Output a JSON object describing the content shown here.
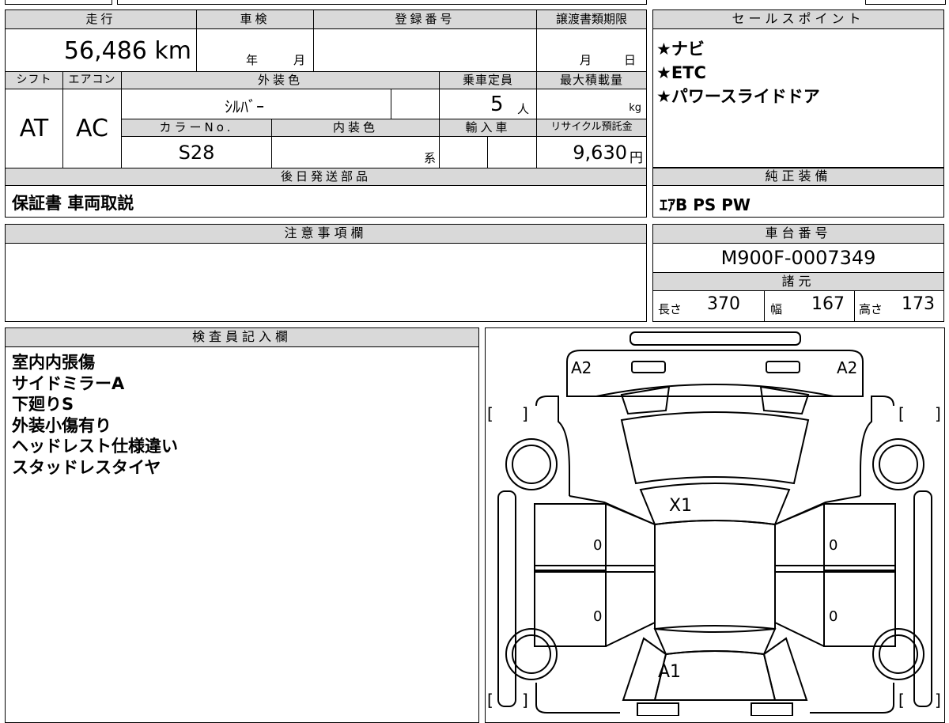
{
  "form": {
    "headers": {
      "mileage": "走行",
      "inspection": "車検",
      "registration": "登録番号",
      "transfer_deadline": "譲渡書類期限",
      "sales_points": "セールスポイント",
      "shift": "シフト",
      "aircon": "エアコン",
      "exterior_color": "外装色",
      "capacity": "乗車定員",
      "max_load": "最大積載量",
      "color_no": "カラーNo.",
      "interior_color": "内装色",
      "import": "輸入車",
      "recycle": "リサイクル預託金",
      "later_parts": "後日発送部品",
      "standard_equipment": "純正装備",
      "notes": "注意事項欄",
      "chassis_no": "車台番号",
      "specs": "諸元",
      "inspector": "検査員記入欄"
    },
    "values": {
      "mileage": "56,486 km",
      "inspection_year": "年",
      "inspection_month": "月",
      "transfer_month": "月",
      "transfer_day": "日",
      "shift": "AT",
      "aircon": "AC",
      "exterior_color": "ｼﾙﾊﾞｰ",
      "capacity_num": "5",
      "capacity_unit": "人",
      "max_load_unit": "kg",
      "color_no": "S28",
      "interior_suffix": "系",
      "recycle_fee": "9,630",
      "recycle_unit": "円",
      "later_parts": "保証書 車両取説",
      "standard_equipment": "ｴｱB PS PW",
      "chassis_no": "M900F-0007349",
      "length_label": "長さ",
      "length": "370",
      "width_label": "幅",
      "width": "167",
      "height_label": "高さ",
      "height": "173"
    },
    "sales_points": [
      "★ナビ",
      "★ETC",
      "★パワースライドドア"
    ],
    "inspector_notes": [
      "室内内張傷",
      "サイドミラーA",
      "下廻りS",
      "外装小傷有り",
      "ヘッドレスト仕様違い",
      "スタッドレスタイヤ"
    ],
    "diagram_marks": {
      "front_left": "A2",
      "front_right": "A2",
      "hood": "X1",
      "door_fl": "0",
      "door_rl": "0",
      "door_fr": "0",
      "door_rr": "0",
      "rear": "A1"
    },
    "brackets": {
      "open": "[",
      "close": "]"
    }
  }
}
